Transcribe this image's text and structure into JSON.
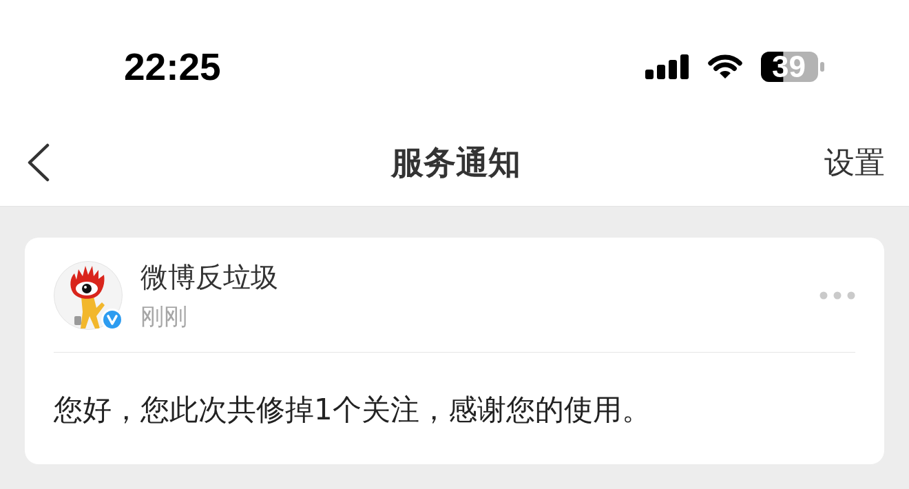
{
  "status_bar": {
    "time": "22:25",
    "battery": "39"
  },
  "nav_bar": {
    "title": "服务通知",
    "action": "设置"
  },
  "notifications": [
    {
      "sender": "微博反垃圾",
      "verified": true,
      "time": "刚刚",
      "message": "您好，您此次共修掉1个关注，感谢您的使用。"
    }
  ]
}
